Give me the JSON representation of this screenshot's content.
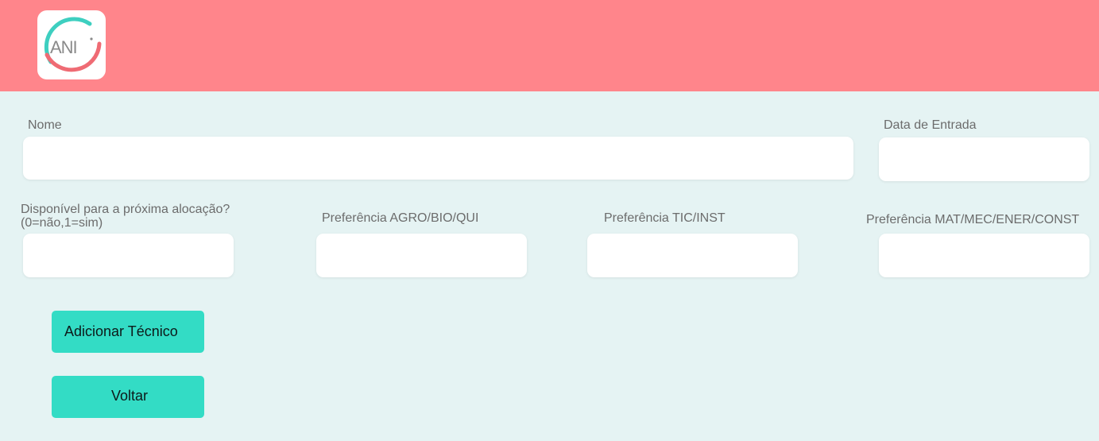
{
  "header": {
    "logo_text": "ANI",
    "background_color": "#ff858b"
  },
  "form": {
    "nome": {
      "label": "Nome",
      "value": "",
      "placeholder": ""
    },
    "data_entrada": {
      "label": "Data de Entrada",
      "value": "",
      "placeholder": ""
    },
    "disponivel": {
      "label_line1": "Disponível para a próxima alocação?",
      "label_line2": "(0=não,1=sim)",
      "value": "",
      "placeholder": ""
    },
    "pref_agro": {
      "label": "Preferência AGRO/BIO/QUI",
      "value": "",
      "placeholder": ""
    },
    "pref_tic": {
      "label": "Preferência TIC/INST",
      "value": "",
      "placeholder": ""
    },
    "pref_mat": {
      "label": "Preferência MAT/MEC/ENER/CONST",
      "value": "",
      "placeholder": ""
    }
  },
  "actions": {
    "add_label": "Adicionar Técnico",
    "back_label": "Voltar",
    "button_color": "#33dcc5"
  },
  "colors": {
    "page_background": "#e5f3f3",
    "logo_teal": "#3ecfc0",
    "logo_coral": "#ef6b74"
  }
}
